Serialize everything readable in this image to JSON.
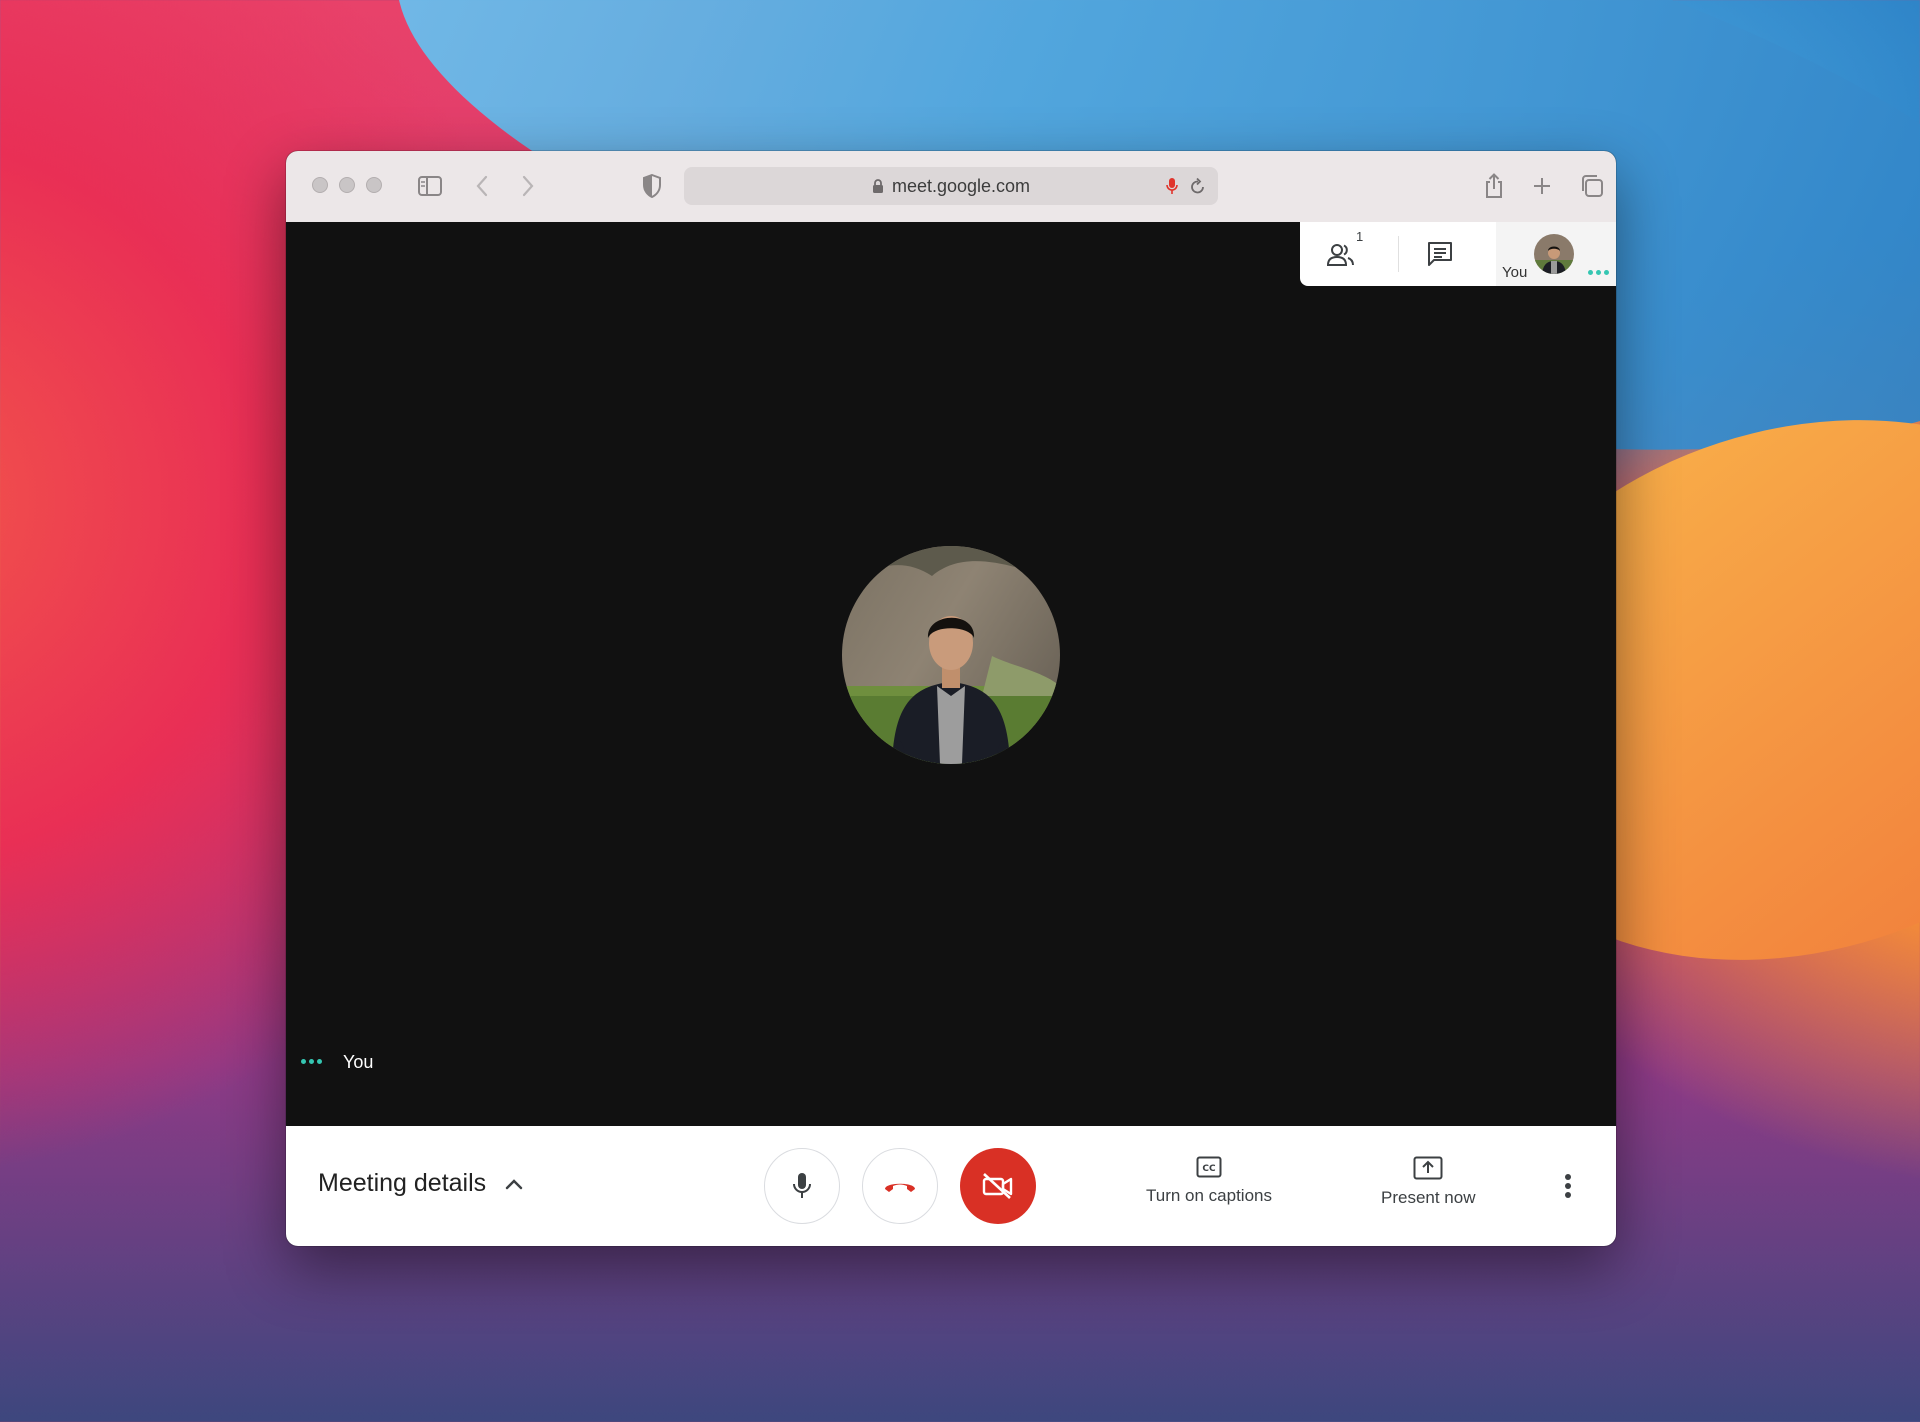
{
  "browser": {
    "url": "meet.google.com"
  },
  "top_panel": {
    "participant_count": "1",
    "self_label": "You"
  },
  "stage": {
    "self_name": "You"
  },
  "bottom_bar": {
    "meeting_details": "Meeting details",
    "captions_label": "Turn on captions",
    "present_label": "Present now"
  },
  "colors": {
    "hangup_red": "#d93025",
    "speaking_dots": "#35c6b2",
    "stage_bg": "#111111"
  },
  "icons": [
    "sidebar-icon",
    "back-icon",
    "forward-icon",
    "shield-icon",
    "lock-icon",
    "mic-recording-icon",
    "reload-icon",
    "share-icon",
    "new-tab-icon",
    "tabs-overview-icon",
    "people-icon",
    "chat-icon",
    "mic-icon",
    "hangup-icon",
    "camera-off-icon",
    "captions-icon",
    "present-icon",
    "more-vert-icon"
  ]
}
